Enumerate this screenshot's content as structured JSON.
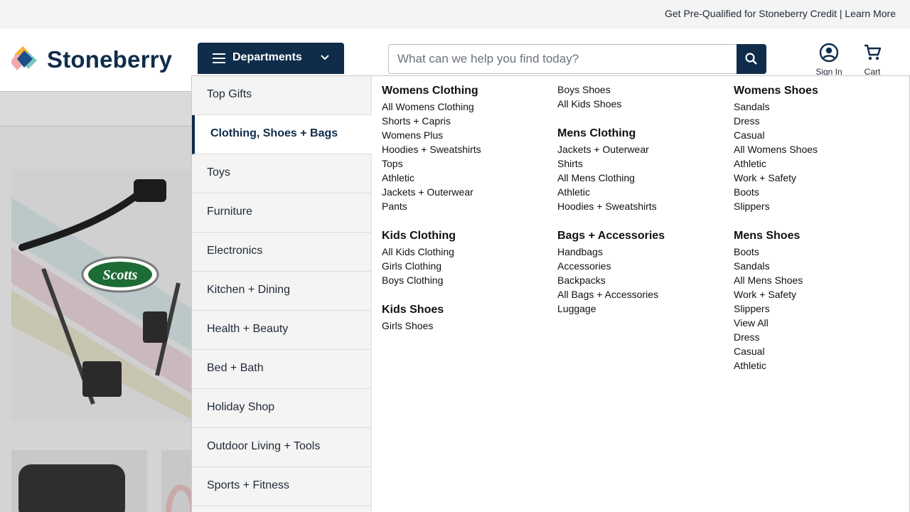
{
  "promo": {
    "text": "Get Pre-Qualified for Stoneberry Credit | Learn More"
  },
  "header": {
    "brand": "Stoneberry",
    "departments_label": "Departments",
    "search_placeholder": "What can we help you find today?",
    "sign_in": "Sign In",
    "cart": "Cart"
  },
  "categories": [
    "Top Gifts",
    "Clothing, Shoes + Bags",
    "Toys",
    "Furniture",
    "Electronics",
    "Kitchen + Dining",
    "Health + Beauty",
    "Bed + Bath",
    "Holiday Shop",
    "Outdoor Living + Tools",
    "Sports + Fitness"
  ],
  "active_category": "Clothing, Shoes + Bags",
  "menu": {
    "col1": {
      "womens_clothing": {
        "title": "Womens Clothing",
        "links": [
          "All Womens Clothing",
          "Shorts + Capris",
          "Womens Plus",
          "Hoodies + Sweatshirts",
          "Tops",
          "Athletic",
          "Jackets + Outerwear",
          "Pants"
        ]
      },
      "kids_clothing": {
        "title": "Kids Clothing",
        "links": [
          "All Kids Clothing",
          "Girls Clothing",
          "Boys Clothing"
        ]
      },
      "kids_shoes": {
        "title": "Kids Shoes",
        "links": [
          "Girls Shoes"
        ]
      }
    },
    "col2": {
      "kids_shoes_cont": {
        "links": [
          "Boys Shoes",
          "All Kids Shoes"
        ]
      },
      "mens_clothing": {
        "title": "Mens Clothing",
        "links": [
          "Jackets + Outerwear",
          "Shirts",
          "All Mens Clothing",
          "Athletic",
          "Hoodies + Sweatshirts"
        ]
      },
      "bags": {
        "title": "Bags + Accessories",
        "links": [
          "Handbags",
          "Accessories",
          "Backpacks",
          "All Bags + Accessories",
          "Luggage"
        ]
      }
    },
    "col3": {
      "womens_shoes": {
        "title": "Womens Shoes",
        "links": [
          "Sandals",
          "Dress",
          "Casual",
          "All Womens Shoes",
          "Athletic",
          "Work + Safety",
          "Boots",
          "Slippers"
        ]
      },
      "mens_shoes": {
        "title": "Mens Shoes",
        "links": [
          "Boots",
          "Sandals",
          "All Mens Shoes",
          "Work + Safety",
          "Slippers",
          "View All",
          "Dress",
          "Casual",
          "Athletic"
        ]
      }
    }
  },
  "hero": {
    "brand_badge": "Scotts"
  },
  "colors": {
    "navy": "#0f2d4a",
    "overlay_gray": "#d4d4d4",
    "scotts_green": "#1d8a3b"
  }
}
